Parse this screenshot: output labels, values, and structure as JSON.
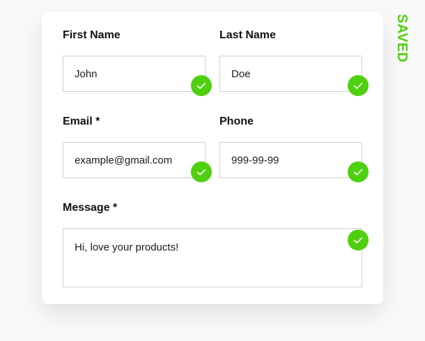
{
  "form": {
    "first_name": {
      "label": "First Name",
      "value": "John"
    },
    "last_name": {
      "label": "Last Name",
      "value": "Doe"
    },
    "email": {
      "label": "Email *",
      "value": "example@gmail.com"
    },
    "phone": {
      "label": "Phone",
      "value": "999-99-99"
    },
    "message": {
      "label": "Message *",
      "value": "Hi, love your products!"
    }
  },
  "status": {
    "saved_text": "SAVED",
    "valid_icon": "check-icon",
    "accent_color": "#4fd00f"
  }
}
